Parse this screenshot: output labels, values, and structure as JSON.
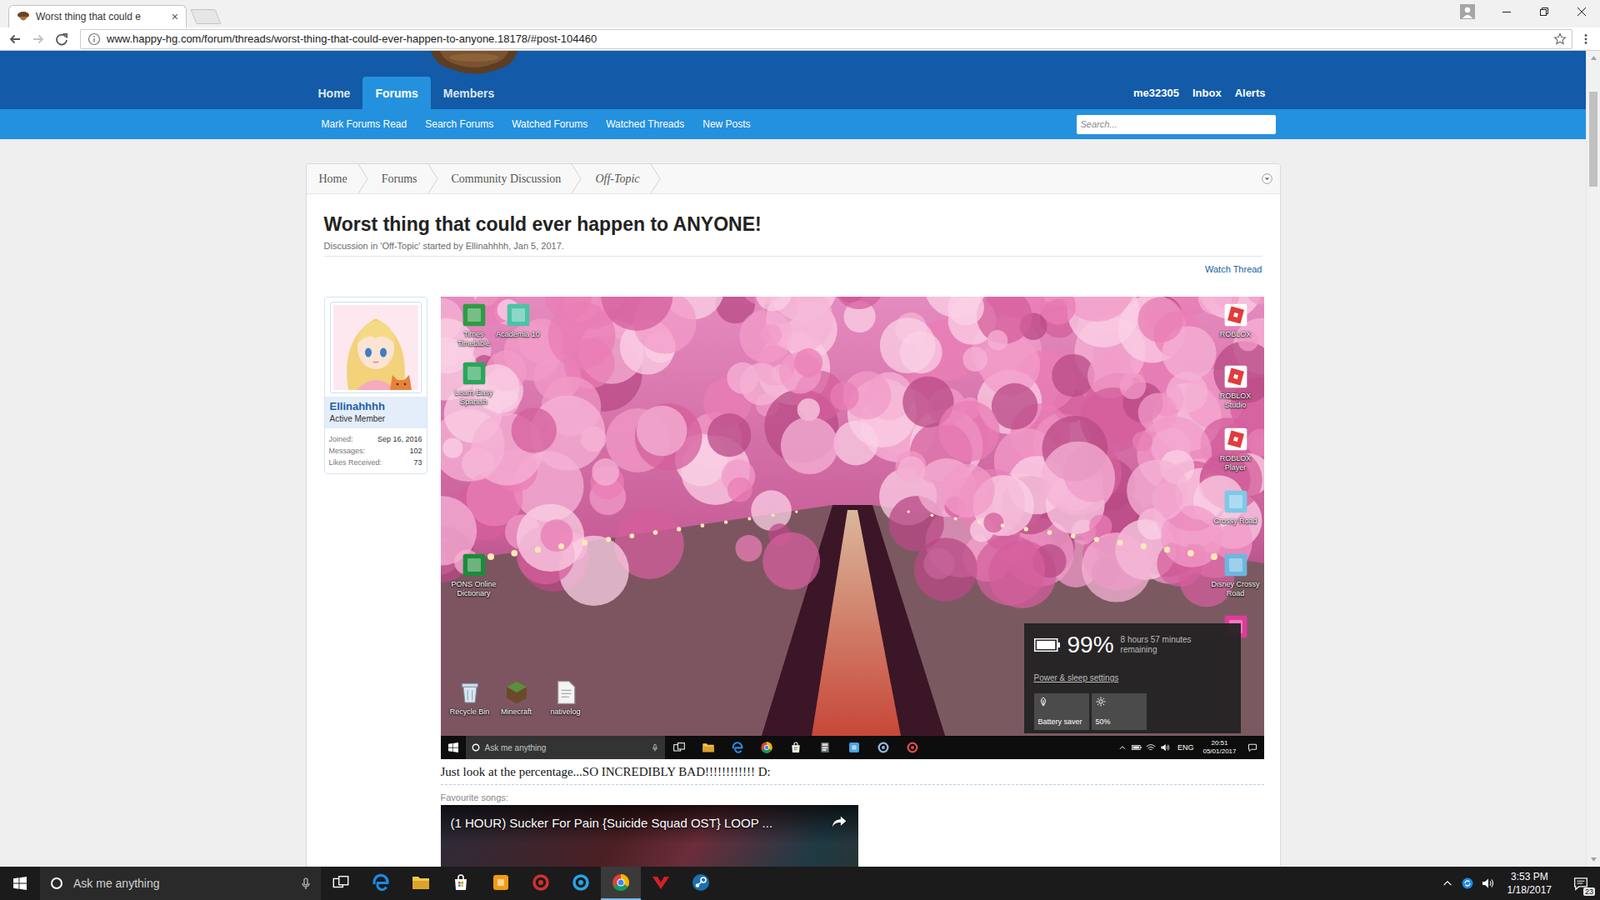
{
  "browser": {
    "tabs": [
      {
        "title": "Worst thing that could e",
        "selected": true,
        "close": "×"
      }
    ],
    "address": "www.happy-hg.com/forum/threads/worst-thing-that-could-ever-happen-to-anyone.18178/#post-104460",
    "bookmarked": false,
    "scrollbar": {
      "level": 0.125
    }
  },
  "site": {
    "nav": [
      {
        "label": "Home",
        "selected": false
      },
      {
        "label": "Forums",
        "selected": true
      },
      {
        "label": "Members",
        "selected": false
      }
    ],
    "user_nav": [
      "me32305",
      "Inbox",
      "Alerts"
    ],
    "sub_nav": [
      "Mark Forums Read",
      "Search Forums",
      "Watched Forums",
      "Watched Threads",
      "New Posts"
    ],
    "search": {
      "placeholder": "Search..."
    }
  },
  "breadcrumb": [
    {
      "label": "Home",
      "current": false
    },
    {
      "label": "Forums",
      "current": false
    },
    {
      "label": "Community Discussion",
      "current": false
    },
    {
      "label": "Off-Topic",
      "current": true
    }
  ],
  "thread": {
    "title": "Worst thing that could ever happen to ANYONE!",
    "meta": "Discussion in 'Off-Topic' started by Ellinahhhh, Jan 5, 2017.",
    "watch": "Watch Thread"
  },
  "post": {
    "author": {
      "name": "Ellinahhhh",
      "title": "Active Member",
      "stats": [
        {
          "label": "Joined:",
          "value": "Sep 16, 2016"
        },
        {
          "label": "Messages:",
          "value": "102"
        },
        {
          "label": "Likes Received:",
          "value": "73"
        }
      ]
    },
    "screenshot": {
      "desktop_icons": [
        {
          "label": "Times Timetable",
          "kind": "tile",
          "color": "#2e9b45"
        },
        {
          "label": "Academia 10",
          "kind": "tile",
          "color": "#4cc3a6"
        },
        {
          "label": "Learn Easy Spanish",
          "kind": "tile",
          "color": "#2aa55a"
        },
        {
          "label": "PONS Online Dictionary",
          "kind": "tile",
          "color": "#1f8a3a"
        },
        {
          "label": "Recycle Bin",
          "kind": "recycle-bin",
          "color": "#d9e6f2"
        },
        {
          "label": "Minecraft",
          "kind": "cube",
          "color": "#5b8f3a"
        },
        {
          "label": "nativelog",
          "kind": "file",
          "color": "#f4f4f4"
        },
        {
          "label": "ROBLOX",
          "kind": "roblox",
          "color": "#e23b3b"
        },
        {
          "label": "ROBLOX Studio",
          "kind": "roblox",
          "color": "#e23b3b"
        },
        {
          "label": "ROBLOX Player",
          "kind": "roblox",
          "color": "#e23b3b"
        },
        {
          "label": "Crossy Road",
          "kind": "tile",
          "color": "#7ec8e8"
        },
        {
          "label": "Disney Crossy Road",
          "kind": "tile",
          "color": "#6bb7e0"
        },
        {
          "kind": "tile",
          "color": "#e0399a"
        }
      ],
      "battery_flyout": {
        "percent": "99%",
        "remaining": "8 hours 57 minutes remaining",
        "level": 0.99,
        "settings": "Power & sleep settings",
        "tiles": [
          {
            "label": "Battery saver",
            "kind": "battery-saver",
            "on": false
          },
          {
            "label": "50%",
            "kind": "brightness",
            "on": false
          }
        ]
      },
      "taskbar": {
        "search": "Ask me anything",
        "apps": [
          {
            "kind": "taskview",
            "color": "#ffffff"
          },
          {
            "kind": "folder",
            "color": "#f2c94c"
          },
          {
            "kind": "edge",
            "color": "#2b8ae0"
          },
          {
            "kind": "chrome",
            "color": "#0f9d58"
          },
          {
            "kind": "store",
            "color": "#ffffff"
          },
          {
            "kind": "calculator",
            "color": "#6d6d6d"
          },
          {
            "kind": "square",
            "color": "#4aa3df"
          },
          {
            "kind": "ring",
            "color": "#8fb8e0"
          },
          {
            "kind": "ring",
            "color": "#e04a4a"
          }
        ],
        "language": "ENG",
        "time": "20:51",
        "date": "05/01/2017"
      }
    },
    "message": "Just look at the percentage...SO INCREDIBLY BAD!!!!!!!!!!!! D:",
    "signature": {
      "label": "Favourite songs:",
      "video_title": "(1 HOUR) Sucker For Pain {Suicide Squad OST} LOOP ..."
    }
  },
  "taskbar": {
    "search": "Ask me anything",
    "apps": [
      {
        "kind": "edge",
        "color": "#1e88e5",
        "selected": false
      },
      {
        "kind": "folder",
        "color": "#f2c94c",
        "selected": false
      },
      {
        "kind": "store",
        "color": "#ffffff",
        "selected": false
      },
      {
        "kind": "square",
        "color": "#f39c12",
        "selected": false
      },
      {
        "kind": "ring",
        "color": "#d32f2f",
        "selected": false
      },
      {
        "kind": "ring",
        "color": "#29a3e3",
        "selected": false
      },
      {
        "kind": "chrome",
        "color": "#0f9d58",
        "selected": true
      },
      {
        "kind": "y",
        "color": "#d61f26",
        "selected": false
      },
      {
        "kind": "steam",
        "color": "#1b6fb0",
        "selected": false
      }
    ],
    "time": "3:53 PM",
    "date": "1/18/2017",
    "notifications": "23"
  }
}
